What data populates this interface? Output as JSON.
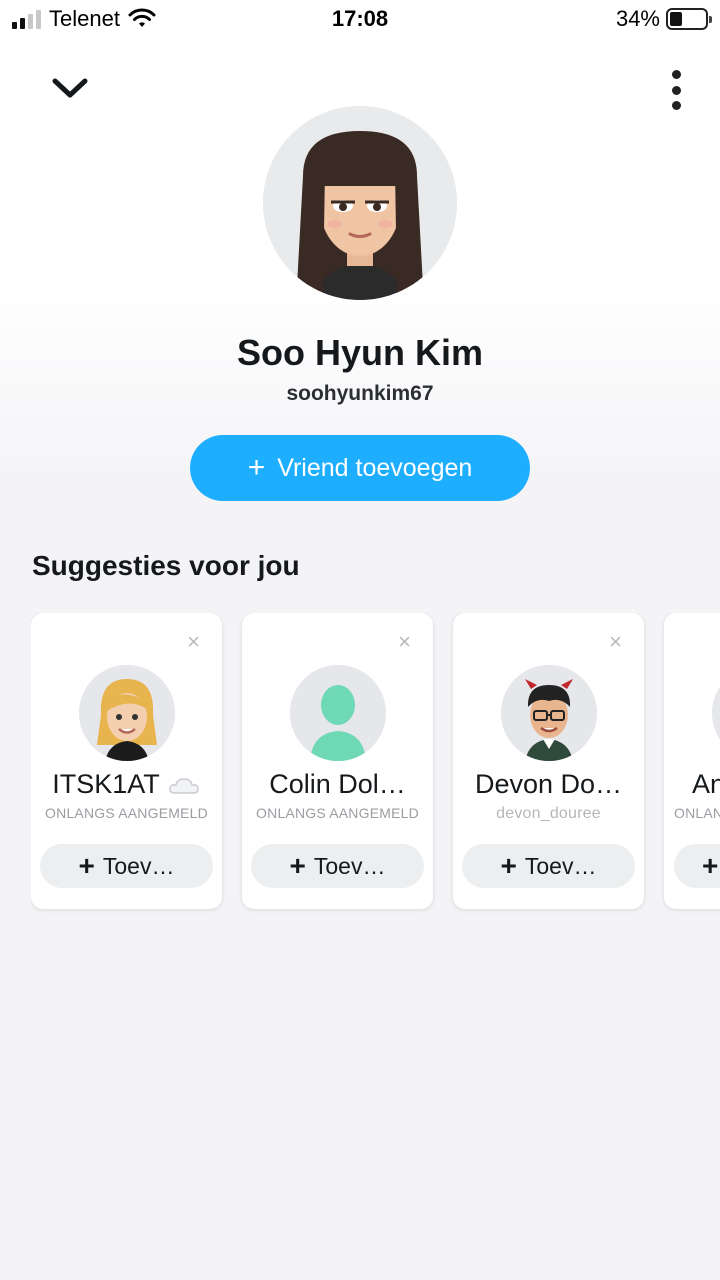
{
  "status_bar": {
    "carrier": "Telenet",
    "time": "17:08",
    "battery": "34%",
    "battery_level": 0.34
  },
  "profile": {
    "name": "Soo Hyun Kim",
    "username": "soohyunkim67",
    "add_friend_label": "Vriend toevoegen",
    "add_friend_plus": "+"
  },
  "suggestions": {
    "title": "Suggesties voor jou",
    "close_symbol": "×",
    "cards": [
      {
        "name": "ITSK1AT",
        "sub": "ONLANGS AANGEMELD",
        "add_label": "Toev…",
        "plus": "+"
      },
      {
        "name": "Colin Dol…",
        "sub": "ONLANGS AANGEMELD",
        "add_label": "Toev…",
        "plus": "+"
      },
      {
        "name": "Devon Do…",
        "sub": "devon_douree",
        "add_label": "Toev…",
        "plus": "+"
      },
      {
        "name": "An",
        "sub": "ONLAN",
        "add_label": "",
        "plus": "+"
      }
    ]
  },
  "colors": {
    "accent": "#1eaeff",
    "default_avatar": "#6fd8b5"
  }
}
